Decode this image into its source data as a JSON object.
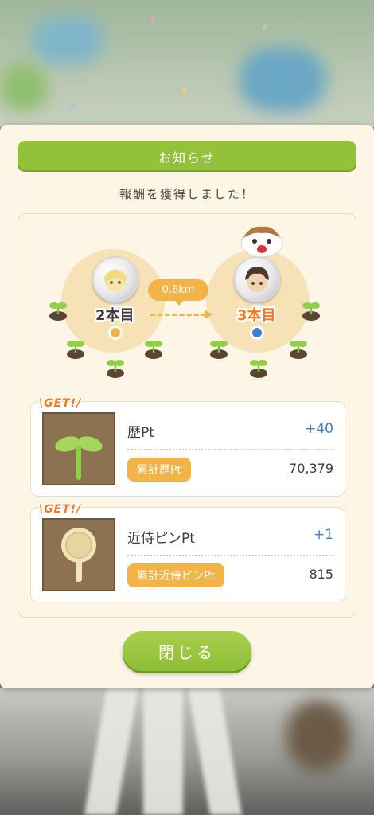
{
  "dialog": {
    "title": "お知らせ",
    "subtitle": "報酬を獲得しました！"
  },
  "progress": {
    "from_label": "2本目",
    "to_label": "3本目",
    "distance": "0.6km",
    "from_color": "#3f3b36",
    "to_color": "#f47a21"
  },
  "rewards": [
    {
      "get_tag": "\\GET!/",
      "icon": "sprout-icon",
      "name": "歴Pt",
      "gain": "+40",
      "total_label": "累計歴Pt",
      "total_value": "70,379"
    },
    {
      "get_tag": "\\GET!/",
      "icon": "pin-icon",
      "name": "近侍ピンPt",
      "gain": "+1",
      "total_label": "累計近侍ピンPt",
      "total_value": "815"
    }
  ],
  "close_button": {
    "label": "閉じる"
  },
  "colors": {
    "accent_green": "#93c23a",
    "accent_orange": "#f2b347",
    "gain_blue": "#3c7fd0"
  }
}
